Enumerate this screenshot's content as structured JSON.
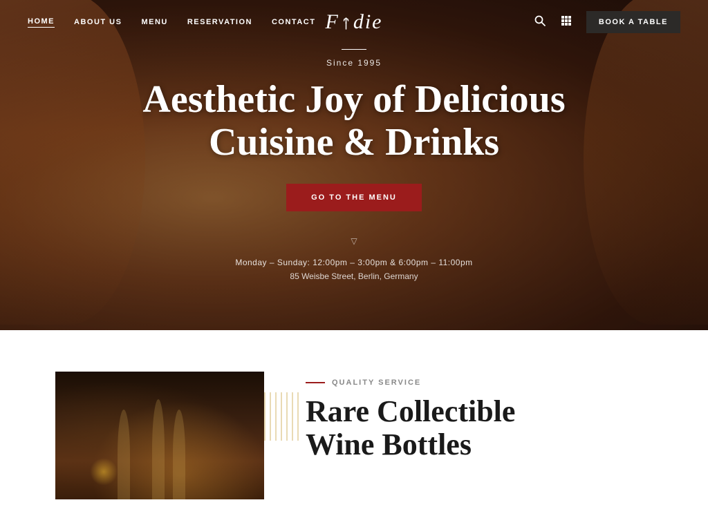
{
  "nav": {
    "links": [
      {
        "label": "Home",
        "active": true
      },
      {
        "label": "About Us",
        "active": false
      },
      {
        "label": "Menu",
        "active": false
      },
      {
        "label": "Reservation",
        "active": false
      },
      {
        "label": "Contact",
        "active": false
      }
    ],
    "logo": "Foodie",
    "book_button": "Book A Table"
  },
  "hero": {
    "divider": "",
    "since": "Since 1995",
    "title_line1": "Aesthetic Joy of Delicious",
    "title_line2": "Cuisine & Drinks",
    "cta_button": "Go To The Menu",
    "triangle": "▽",
    "hours": "Monday – Sunday: 12:00pm – 3:00pm & 6:00pm – 11:00pm",
    "address": "85 Weisbe Street, Berlin, Germany"
  },
  "section": {
    "quality_label": "Quality Service",
    "title_line1": "Rare Collectible",
    "title_line2": "Wine Bottles"
  },
  "icons": {
    "search": "🔍",
    "grid": "⠿"
  }
}
